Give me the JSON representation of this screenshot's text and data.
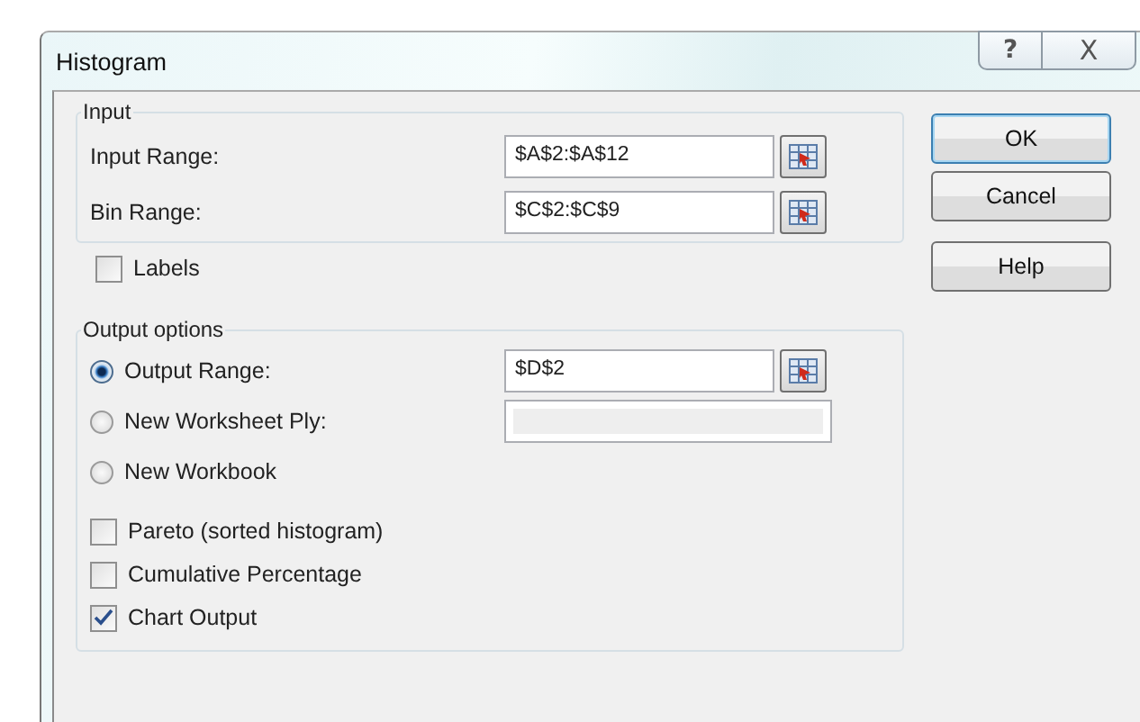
{
  "window": {
    "title": "Histogram",
    "controls": [
      {
        "kind": "help",
        "label": "?"
      },
      {
        "kind": "close",
        "label": "X"
      }
    ]
  },
  "input_group": {
    "title": "Input",
    "fields": [
      {
        "label": "Input Range:",
        "value": "$A$2:$A$12"
      },
      {
        "label": "Bin Range:",
        "value": "$C$2:$C$9"
      }
    ]
  },
  "labels_checkbox": {
    "label": "Labels",
    "checked": false
  },
  "output_group": {
    "title": "Output options",
    "radios": [
      {
        "label": "Output Range:",
        "selected": true,
        "field": {
          "value": "$D$2",
          "enabled": true
        }
      },
      {
        "label": "New Worksheet Ply:",
        "selected": false,
        "field": {
          "enabled": false
        }
      },
      {
        "label": "New Workbook",
        "selected": false
      }
    ],
    "checkboxes": [
      {
        "label": "Pareto (sorted histogram)",
        "checked": false
      },
      {
        "label": "Cumulative Percentage",
        "checked": false
      },
      {
        "label": "Chart Output",
        "checked": true
      }
    ]
  },
  "buttons": [
    {
      "label": "OK",
      "default": true
    },
    {
      "label": "Cancel",
      "default": false
    },
    {
      "label": "Help",
      "default": false
    }
  ]
}
